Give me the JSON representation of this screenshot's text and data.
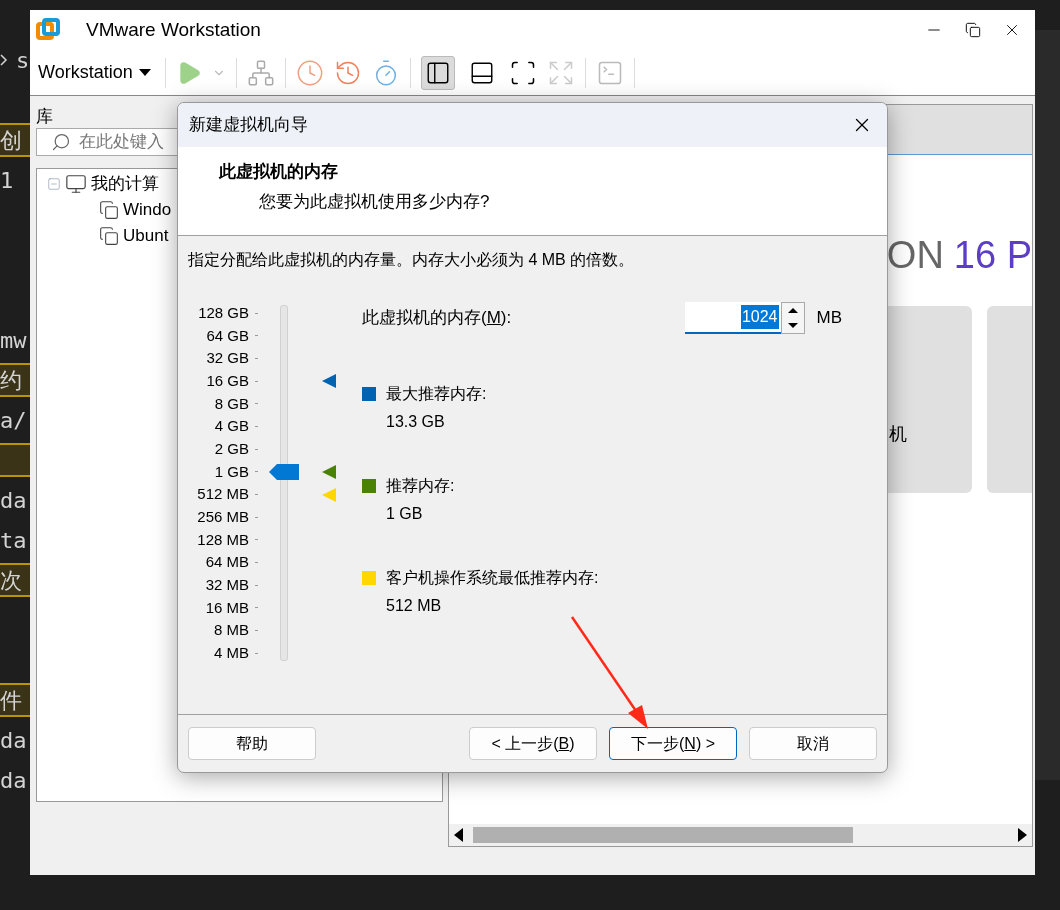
{
  "editor_lines": [
    {
      "kind": "blank"
    },
    {
      "kind": "prompt",
      "text": "s"
    },
    {
      "kind": "blank"
    },
    {
      "kind": "highlight",
      "text": "创"
    },
    {
      "kind": "text",
      "text": "1"
    },
    {
      "kind": "blank"
    },
    {
      "kind": "blank"
    },
    {
      "kind": "blank"
    },
    {
      "kind": "text",
      "text": "mw"
    },
    {
      "kind": "highlight",
      "text": "约"
    },
    {
      "kind": "text",
      "text": "a/"
    },
    {
      "kind": "highlight"
    },
    {
      "kind": "text",
      "text": "da"
    },
    {
      "kind": "text",
      "text": "ta"
    },
    {
      "kind": "highlight",
      "text": "次"
    },
    {
      "kind": "blank"
    },
    {
      "kind": "blank"
    },
    {
      "kind": "highlight",
      "text": "件"
    },
    {
      "kind": "text",
      "text": "da"
    },
    {
      "kind": "text",
      "text": "da"
    }
  ],
  "window": {
    "title": "VMware Workstation",
    "menu": "Workstation",
    "view_toggles": [
      {
        "selected": true
      },
      {
        "selected": false
      }
    ]
  },
  "library": {
    "title": "库",
    "search_placeholder": "在此处键入",
    "tree": [
      {
        "label": "我的计算",
        "expanded": true,
        "children": [
          {
            "label": "Windo"
          },
          {
            "label": "Ubunt"
          }
        ]
      }
    ]
  },
  "home": {
    "banner_plain": "ON",
    "banner_accent": "16 P",
    "card_label": "机"
  },
  "dialog": {
    "title": "新建虚拟机向导",
    "heading": "此虚拟机的内存",
    "subheading": "您要为此虚拟机使用多少内存?",
    "description": "指定分配给此虚拟机的内存量。内存大小必须为 4 MB 的倍数。",
    "scale": [
      {
        "label": "128 GB"
      },
      {
        "label": "64 GB"
      },
      {
        "label": "32 GB"
      },
      {
        "label": "16 GB",
        "color": "#0063b1"
      },
      {
        "label": "8 GB"
      },
      {
        "label": "4 GB"
      },
      {
        "label": "2 GB"
      },
      {
        "label": "1 GB",
        "color": "#498205"
      },
      {
        "label": "512 MB",
        "color": "#ffd700"
      },
      {
        "label": "256 MB"
      },
      {
        "label": "128 MB"
      },
      {
        "label": "64 MB"
      },
      {
        "label": "32 MB"
      },
      {
        "label": "16 MB"
      },
      {
        "label": "8 MB"
      },
      {
        "label": "4 MB"
      }
    ],
    "slider": {
      "level": 0.533
    },
    "memory_field": {
      "label_start": "此虚拟机的内存(",
      "access_key": "M",
      "label_end": "):",
      "value": "1024",
      "unit": "MB"
    },
    "legend": [
      {
        "label": "最大推荐内存:",
        "value": "13.3 GB",
        "color": "#0063b1"
      },
      {
        "label": "推荐内存:",
        "value": "1 GB",
        "color": "#498205"
      },
      {
        "label": "客户机操作系统最低推荐内存:",
        "value": "512 MB",
        "color": "#ffd700"
      }
    ],
    "buttons": [
      {
        "start": "帮助",
        "focused": false
      },
      {
        "start": "< 上一步(",
        "access_key": "B",
        "end": ")",
        "focused": false
      },
      {
        "start": "下一步(",
        "access_key": "N",
        "end": ") >",
        "focused": true
      },
      {
        "start": "取消",
        "focused": false
      }
    ]
  }
}
